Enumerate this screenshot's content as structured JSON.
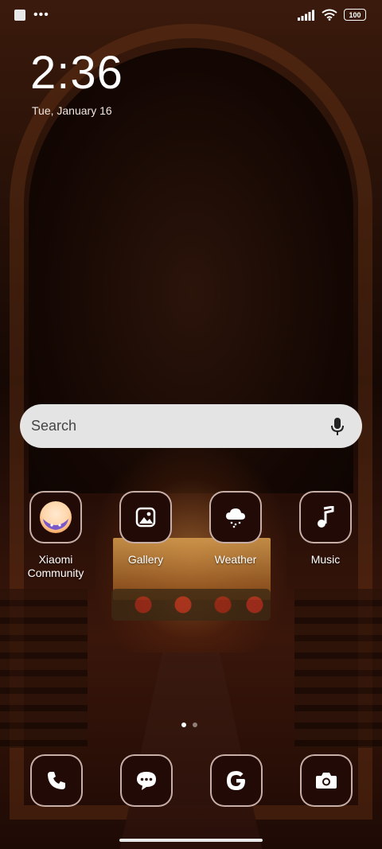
{
  "status_bar": {
    "battery": "100"
  },
  "lock": {
    "time": "2:36",
    "date": "Tue, January 16"
  },
  "search": {
    "placeholder": "Search"
  },
  "apps": [
    {
      "label": "Xiaomi\nCommunity",
      "icon": "xiaomi-community-icon"
    },
    {
      "label": "Gallery",
      "icon": "gallery-icon"
    },
    {
      "label": "Weather",
      "icon": "weather-icon"
    },
    {
      "label": "Music",
      "icon": "music-icon"
    }
  ],
  "dock": [
    {
      "icon": "phone-icon"
    },
    {
      "icon": "messages-icon"
    },
    {
      "icon": "google-icon"
    },
    {
      "icon": "camera-icon"
    }
  ],
  "pager": {
    "pages": 2,
    "active": 1
  }
}
